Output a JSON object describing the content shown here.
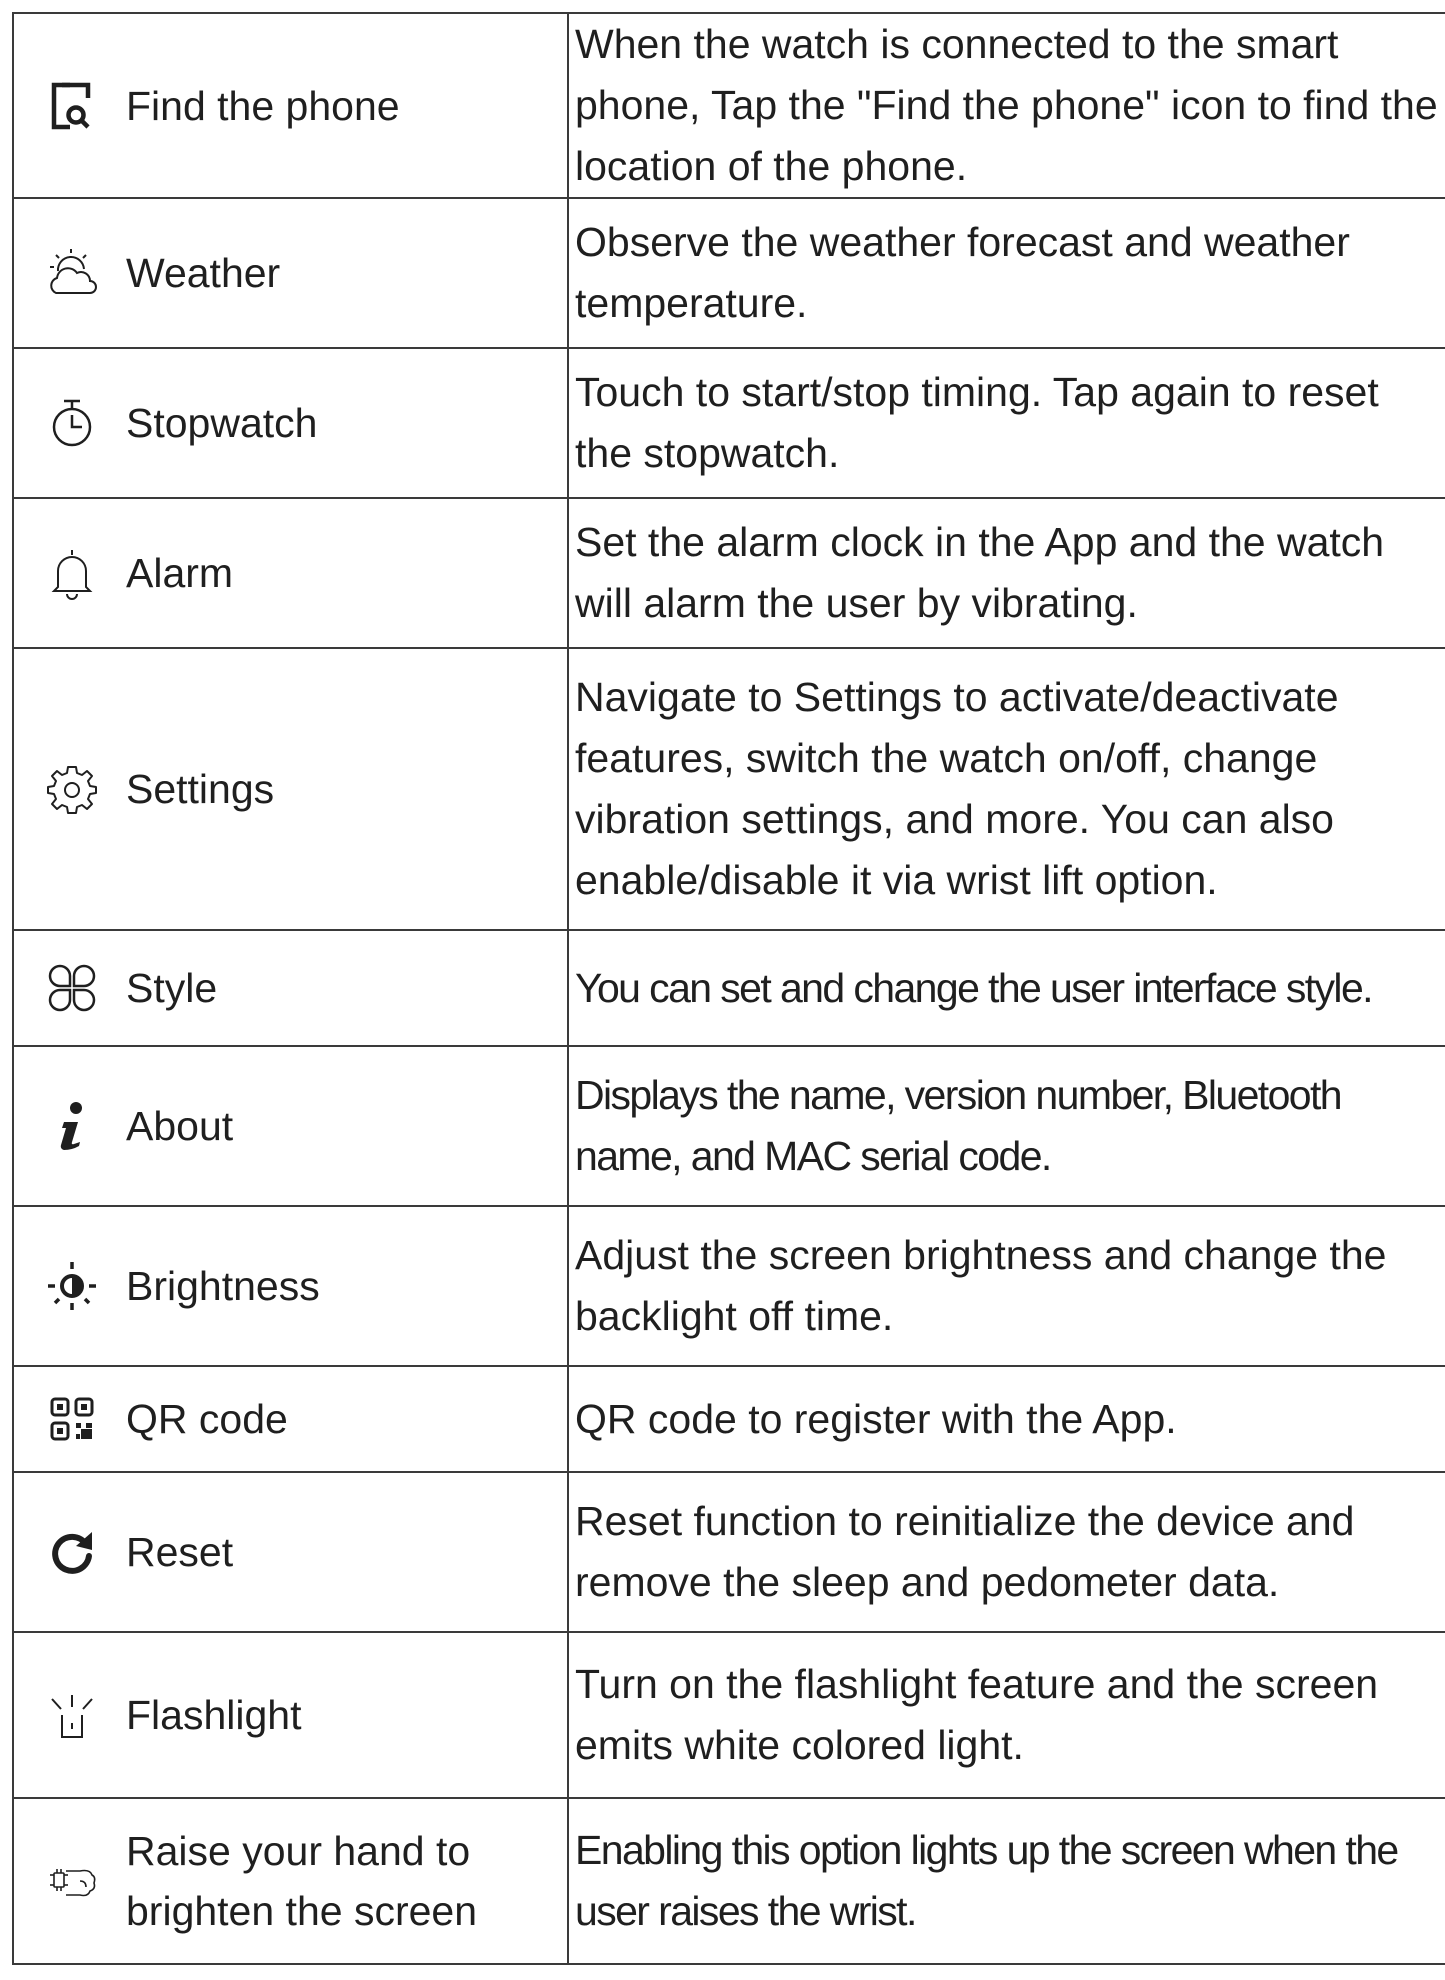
{
  "features": [
    {
      "name": "Find the phone",
      "icon": "find-phone-icon",
      "description": "When the watch is connected to the smart phone, Tap the \"Find the phone\" icon to find the location of the phone."
    },
    {
      "name": "Weather",
      "icon": "weather-icon",
      "description": "Observe the weather forecast and weather temperature."
    },
    {
      "name": "Stopwatch",
      "icon": "stopwatch-icon",
      "description": "Touch to start/stop timing. Tap again to reset the stopwatch."
    },
    {
      "name": "Alarm",
      "icon": "bell-icon",
      "description": "Set the alarm clock in the App and the watch will alarm the user by vibrating."
    },
    {
      "name": "Settings",
      "icon": "gear-icon",
      "description": "Navigate to Settings to activate/deactivate features, switch the watch on/off,  change vibration settings, and more. You can also enable/disable it via wrist lift option."
    },
    {
      "name": "Style",
      "icon": "style-icon",
      "description": "You can set and change the user interface style."
    },
    {
      "name": "About",
      "icon": "info-icon",
      "description": "Displays the name, version number, Bluetooth name, and MAC serial code."
    },
    {
      "name": "Brightness",
      "icon": "brightness-icon",
      "description": "Adjust the screen brightness and change the backlight off time."
    },
    {
      "name": "QR code",
      "icon": "qr-code-icon",
      "description": "QR code to register with the App."
    },
    {
      "name": "Reset",
      "icon": "reset-icon",
      "description": "Reset function to reinitialize the device and remove the sleep and pedometer data."
    },
    {
      "name": "Flashlight",
      "icon": "flashlight-icon",
      "description": "Turn on the flashlight feature and the screen emits white colored light."
    },
    {
      "name": "Raise your hand to brighten the screen",
      "icon": "raise-hand-icon",
      "description": "Enabling this option lights up the screen when the user raises the wrist."
    }
  ]
}
